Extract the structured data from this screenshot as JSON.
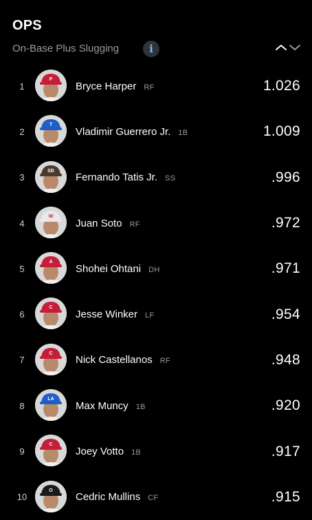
{
  "header": {
    "title": "OPS",
    "subtitle": "On-Base Plus Slugging",
    "info_label": "i",
    "sort_icon": "chevron-up-down-icon"
  },
  "colors": {
    "background": "#000000",
    "text": "#ffffff",
    "muted": "#9a9a9a",
    "info_icon": "#7ab8ff"
  },
  "players": [
    {
      "rank": "1",
      "name": "Bryce Harper",
      "pos": "RF",
      "value": "1.026",
      "cap_color": "#c41e3a",
      "logo": "P"
    },
    {
      "rank": "2",
      "name": "Vladimir Guerrero Jr.",
      "pos": "1B",
      "value": "1.009",
      "cap_color": "#1d5fc7",
      "logo": "T"
    },
    {
      "rank": "3",
      "name": "Fernando Tatis Jr.",
      "pos": "SS",
      "value": ".996",
      "cap_color": "#4a3a2c",
      "logo": "SD"
    },
    {
      "rank": "4",
      "name": "Juan Soto",
      "pos": "RF",
      "value": ".972",
      "cap_color": "#e8e8e8",
      "logo": "W"
    },
    {
      "rank": "5",
      "name": "Shohei Ohtani",
      "pos": "DH",
      "value": ".971",
      "cap_color": "#c41e3a",
      "logo": "A"
    },
    {
      "rank": "6",
      "name": "Jesse Winker",
      "pos": "LF",
      "value": ".954",
      "cap_color": "#c41e3a",
      "logo": "C"
    },
    {
      "rank": "7",
      "name": "Nick Castellanos",
      "pos": "RF",
      "value": ".948",
      "cap_color": "#c41e3a",
      "logo": "C"
    },
    {
      "rank": "8",
      "name": "Max Muncy",
      "pos": "1B",
      "value": ".920",
      "cap_color": "#1d5fc7",
      "logo": "LA"
    },
    {
      "rank": "9",
      "name": "Joey Votto",
      "pos": "1B",
      "value": ".917",
      "cap_color": "#c41e3a",
      "logo": "C"
    },
    {
      "rank": "10",
      "name": "Cedric Mullins",
      "pos": "CF",
      "value": ".915",
      "cap_color": "#1a1a1a",
      "logo": "O"
    }
  ]
}
